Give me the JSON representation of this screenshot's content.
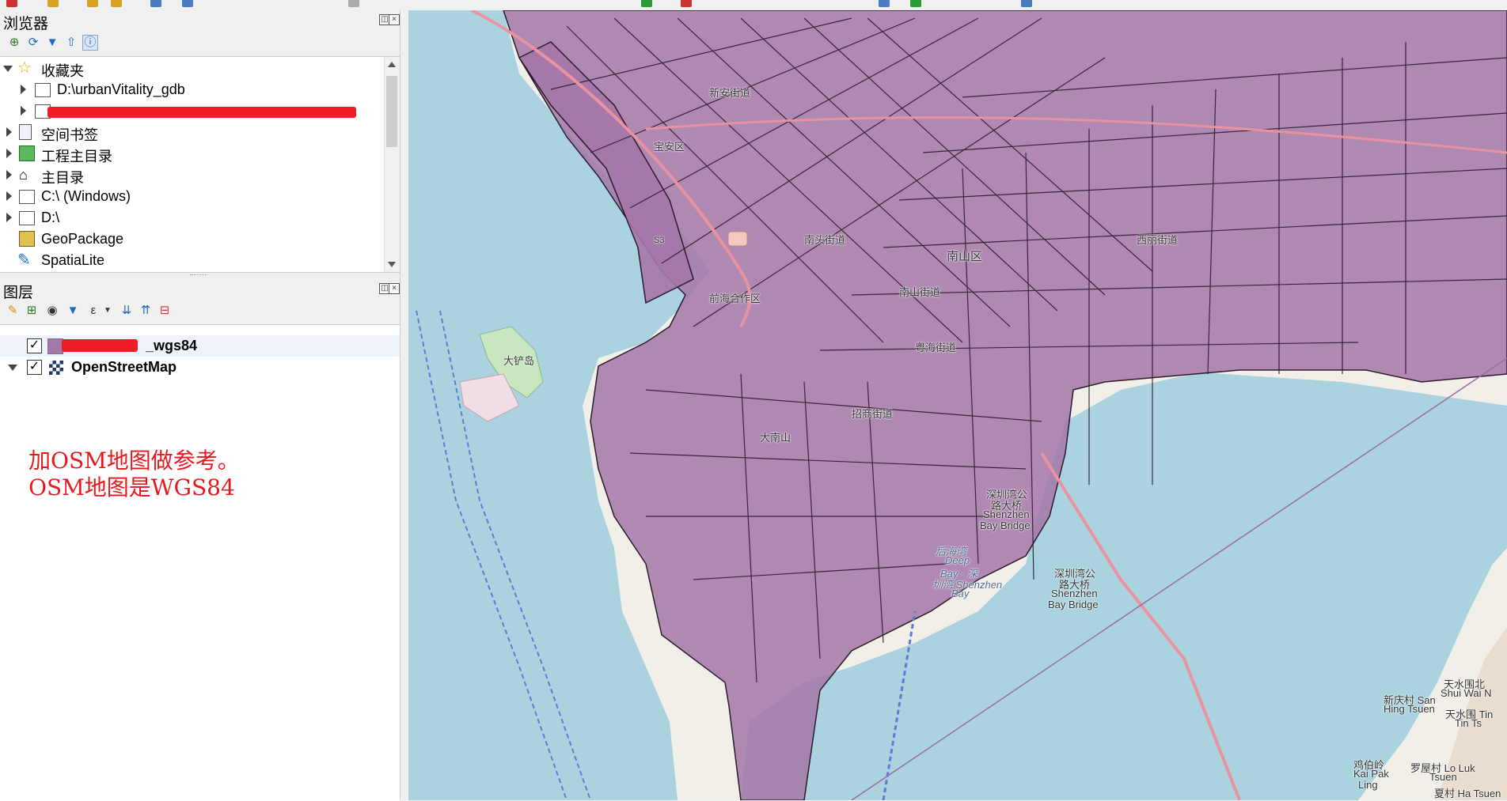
{
  "browser_panel": {
    "title": "浏览器",
    "items": [
      {
        "label": "收藏夹",
        "icon": "star-icon"
      },
      {
        "label": "D:\\urbanVitality_gdb",
        "icon": "folder-icon"
      },
      {
        "label": "",
        "icon": "folder-icon"
      },
      {
        "label": "空间书签",
        "icon": "bookmarks-icon"
      },
      {
        "label": "工程主目录",
        "icon": "project-home-icon"
      },
      {
        "label": "主目录",
        "icon": "home-icon"
      },
      {
        "label": "C:\\ (Windows)",
        "icon": "folder-icon"
      },
      {
        "label": "D:\\",
        "icon": "folder-icon"
      },
      {
        "label": "GeoPackage",
        "icon": "geopackage-icon"
      },
      {
        "label": "SpatiaLite",
        "icon": "spatialite-icon"
      }
    ]
  },
  "layers_panel": {
    "title": "图层",
    "layers": [
      {
        "label": "_wgs84",
        "checked": "✓",
        "color": "#a577a8"
      },
      {
        "label": "OpenStreetMap",
        "checked": "✓"
      }
    ]
  },
  "annotation": {
    "line1": "加OSM地图做参考。",
    "line2": "OSM地图是WGS84",
    "color": "#e8181f"
  },
  "map": {
    "labels": {
      "baoan": "宝安区",
      "nanshan": "南山区",
      "dachan": "大铲岛",
      "nantou": "南头街道",
      "nanshan_st": "南山街道",
      "qianhai": "前海合作区",
      "shekou": "招商街道",
      "yuehai": "粤海街道",
      "xinan": "新安街道",
      "xili": "西丽街道",
      "daxiao": "大南山",
      "bridge1a": "深圳湾公",
      "bridge1b": "路大桥",
      "bridge1c": "Shenzhen",
      "bridge1d": "Bay Bridge",
      "bridge2a": "深圳湾公",
      "bridge2b": "路大桥",
      "bridge2c": "Shenzhen",
      "bridge2d": "Bay Bridge",
      "houhai": "后海湾",
      "deep": "Deep",
      "bay": "Bay · 深",
      "szb": "圳湾 Shenzhen",
      "bayb": "Bay",
      "s3": "S3",
      "tinshui": "天水围北",
      "tinshui2": "Shui Wai N",
      "tinshui3": "天水围 Tin",
      "sanhing": "新庆村 San",
      "hingtsuen": "Hing Tsuen",
      "kaipak": "鸡伯岭",
      "kaipak2": "Kai Pak",
      "ling": "Ling",
      "loluk": "罗屋村 Lo Luk",
      "tsuen": "Tsuen",
      "tintsun": "Tin Ts",
      "haituen": "夏村 Ha Tsuen"
    },
    "colors": {
      "water": "#aad3df",
      "land": "#f2efe9",
      "district_fill": "#a577a8",
      "district_stroke": "#2b1b2b",
      "road": "#e892a2"
    }
  }
}
